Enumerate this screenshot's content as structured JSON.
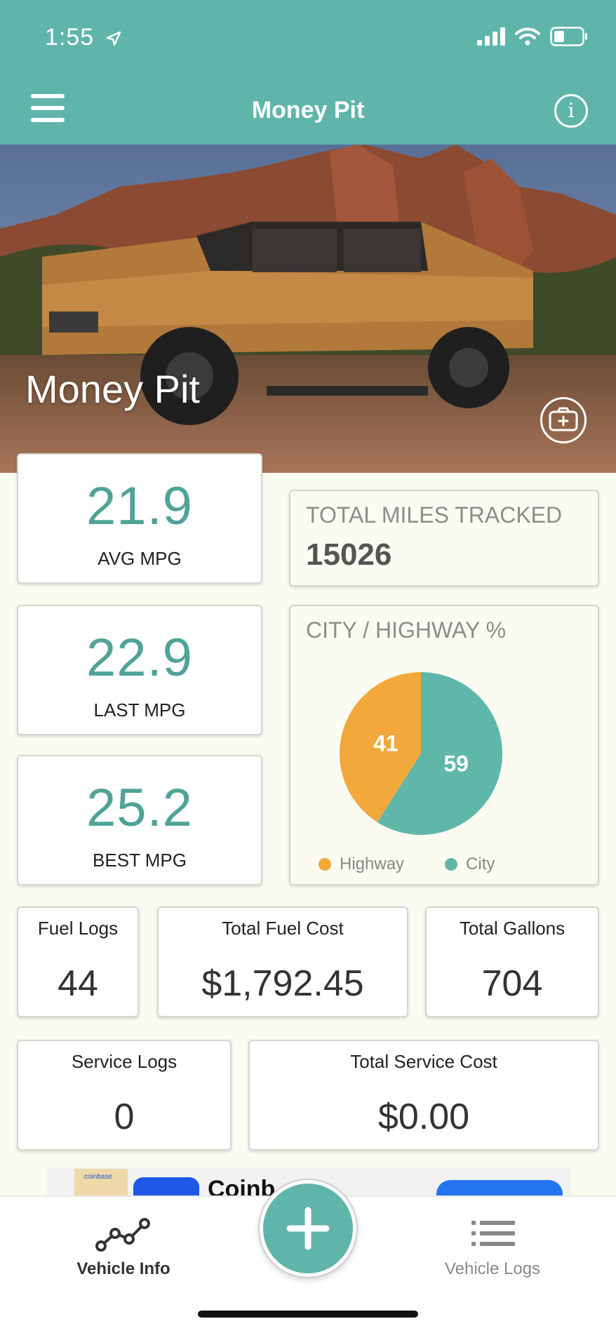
{
  "status_bar": {
    "time": "1:55"
  },
  "header": {
    "title": "Money Pit"
  },
  "hero": {
    "vehicle_name": "Money Pit"
  },
  "mpg": {
    "avg": {
      "value": "21.9",
      "label": "AVG MPG"
    },
    "last": {
      "value": "22.9",
      "label": "LAST MPG"
    },
    "best": {
      "value": "25.2",
      "label": "BEST MPG"
    }
  },
  "miles": {
    "title": "TOTAL MILES TRACKED",
    "value": "15026"
  },
  "city_highway": {
    "title": "CITY / HIGHWAY %",
    "highway_label": "Highway",
    "city_label": "City"
  },
  "chart_data": {
    "type": "pie",
    "title": "CITY / HIGHWAY %",
    "categories": [
      "Highway",
      "City"
    ],
    "values": [
      41,
      59
    ],
    "colors": [
      "#f2a83b",
      "#5fb7aa"
    ],
    "legend": "bottom"
  },
  "stats": {
    "fuel_logs": {
      "label": "Fuel Logs",
      "value": "44"
    },
    "total_fuel_cost": {
      "label": "Total Fuel Cost",
      "value": "$1,792.45"
    },
    "total_gallons": {
      "label": "Total Gallons",
      "value": "704"
    },
    "service_logs": {
      "label": "Service Logs",
      "value": "0"
    },
    "total_service_cost": {
      "label": "Total Service Cost",
      "value": "$0.00"
    }
  },
  "ad": {
    "logo_text": "coinbase",
    "headline": "Coinb"
  },
  "tabs": {
    "vehicle_info": "Vehicle Info",
    "vehicle_logs": "Vehicle Logs"
  },
  "icons": {
    "menu": "hamburger-icon",
    "info": "info-icon",
    "camera": "camera-add-icon",
    "vehicle_info": "line-chart-icon",
    "add": "plus-icon",
    "vehicle_logs": "list-icon"
  },
  "colors": {
    "accent": "#60b5aa",
    "highway": "#f2a83b",
    "city": "#5fb7aa",
    "background": "#fbfbf1"
  }
}
